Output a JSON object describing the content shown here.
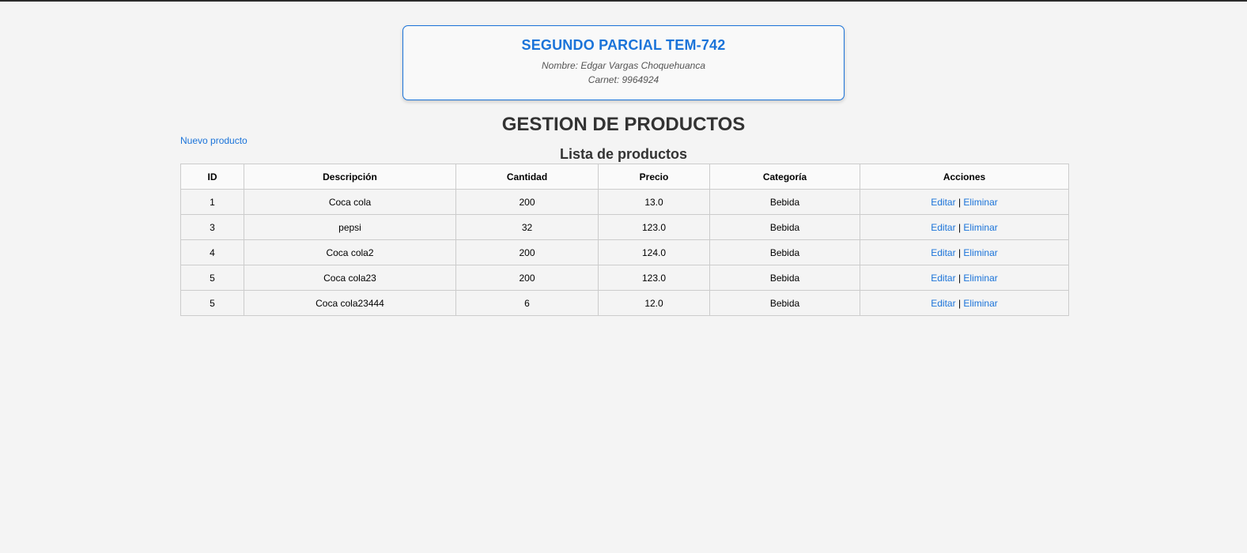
{
  "header": {
    "title": "SEGUNDO PARCIAL TEM-742",
    "name": "Nombre: Edgar Vargas Choquehuanca",
    "carnet": "Carnet: 9964924"
  },
  "page": {
    "title": "GESTION DE PRODUCTOS",
    "new_link": "Nuevo producto",
    "list_title": "Lista de productos"
  },
  "table": {
    "columns": [
      "ID",
      "Descripción",
      "Cantidad",
      "Precio",
      "Categoría",
      "Acciones"
    ],
    "rows": [
      {
        "id": "1",
        "descripcion": "Coca cola",
        "cantidad": "200",
        "precio": "13.0",
        "categoria": "Bebida"
      },
      {
        "id": "3",
        "descripcion": "pepsi",
        "cantidad": "32",
        "precio": "123.0",
        "categoria": "Bebida"
      },
      {
        "id": "4",
        "descripcion": "Coca cola2",
        "cantidad": "200",
        "precio": "124.0",
        "categoria": "Bebida"
      },
      {
        "id": "5",
        "descripcion": "Coca cola23",
        "cantidad": "200",
        "precio": "123.0",
        "categoria": "Bebida"
      },
      {
        "id": "5",
        "descripcion": "Coca cola23444",
        "cantidad": "6",
        "precio": "12.0",
        "categoria": "Bebida"
      }
    ],
    "actions": {
      "edit": "Editar",
      "separator": " | ",
      "delete": "Eliminar"
    }
  },
  "colors": {
    "accent": "#1a73d9",
    "background": "#f4f4f4"
  }
}
